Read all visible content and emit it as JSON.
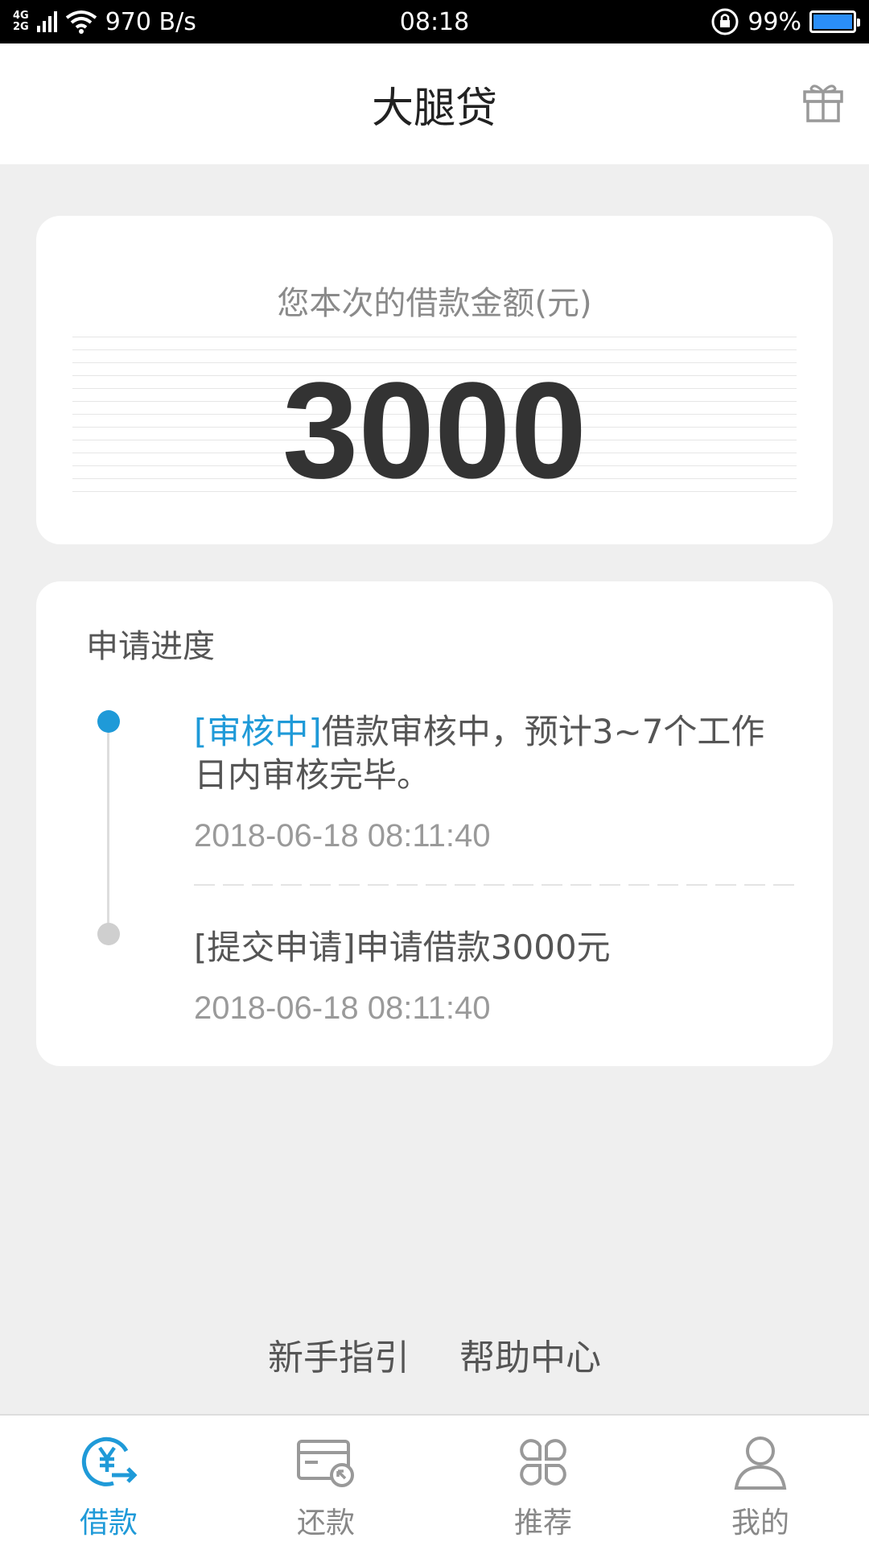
{
  "status_bar": {
    "network_top": "4G",
    "network_bottom": "2G",
    "speed": "970 B/s",
    "time": "08:18",
    "battery": "99%",
    "battery_level": 0.99,
    "icons": [
      "signal-icon",
      "wifi-icon",
      "rotation-lock-icon",
      "battery-icon"
    ]
  },
  "header": {
    "title": "大腿贷",
    "right_icon": "gift-icon"
  },
  "amount_card": {
    "label": "您本次的借款金额(元)",
    "amount": "3000"
  },
  "progress": {
    "title": "申请进度",
    "steps": [
      {
        "status": "[审核中]",
        "message": "借款审核中，预计3~7个工作日内审核完毕。",
        "time": "2018-06-18 08:11:40",
        "active": true
      },
      {
        "status": "[提交申请]",
        "message": "申请借款3000元",
        "time": "2018-06-18 08:11:40",
        "active": false
      }
    ]
  },
  "links": {
    "guide": "新手指引",
    "help": "帮助中心"
  },
  "tabs": [
    {
      "label": "借款",
      "icon": "loan-yen-icon",
      "active": true
    },
    {
      "label": "还款",
      "icon": "repay-card-icon",
      "active": false
    },
    {
      "label": "推荐",
      "icon": "recommend-grid-icon",
      "active": false
    },
    {
      "label": "我的",
      "icon": "profile-user-icon",
      "active": false
    }
  ],
  "colors": {
    "accent": "#1f9ad8",
    "background": "#efefef",
    "card": "#ffffff"
  }
}
